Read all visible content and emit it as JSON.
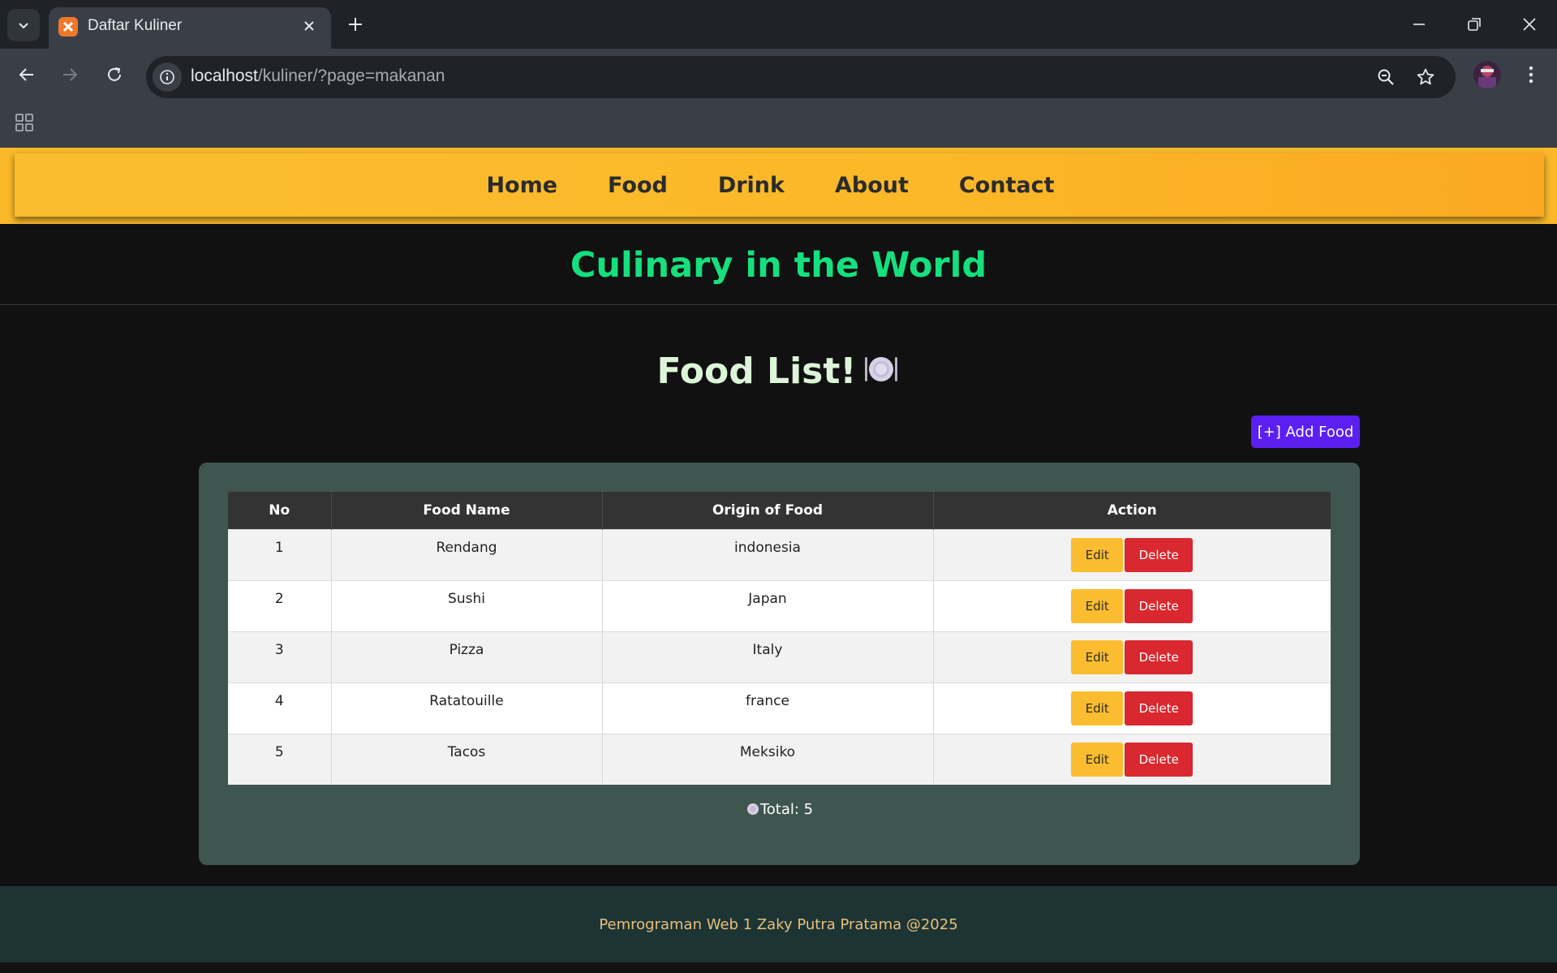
{
  "browser": {
    "tab_title": "Daftar Kuliner",
    "url_host": "localhost",
    "url_path": "/kuliner/?page=makanan"
  },
  "nav": {
    "items": [
      "Home",
      "Food",
      "Drink",
      "About",
      "Contact"
    ]
  },
  "site_title": "Culinary in the World",
  "food_heading": "Food List!",
  "add_button": "[+] Add Food",
  "table": {
    "headers": [
      "No",
      "Food Name",
      "Origin of Food",
      "Action"
    ],
    "rows": [
      {
        "no": "1",
        "name": "Rendang",
        "origin": "indonesia"
      },
      {
        "no": "2",
        "name": "Sushi",
        "origin": "Japan"
      },
      {
        "no": "3",
        "name": "Pizza",
        "origin": "Italy"
      },
      {
        "no": "4",
        "name": "Ratatouille",
        "origin": "france"
      },
      {
        "no": "5",
        "name": "Tacos",
        "origin": "Meksiko"
      }
    ],
    "edit_label": "Edit",
    "delete_label": "Delete"
  },
  "total_label": "Total: 5",
  "footer": "Pemrograman Web 1 Zaky Putra Pratama @2025",
  "colors": {
    "navbar": "#fbbd2f",
    "title": "#16e07e",
    "add_button": "#5b1ff2",
    "edit": "#fbbd2f",
    "delete": "#d9282f",
    "card": "#3f5650",
    "footer_text": "#e7c07a"
  }
}
